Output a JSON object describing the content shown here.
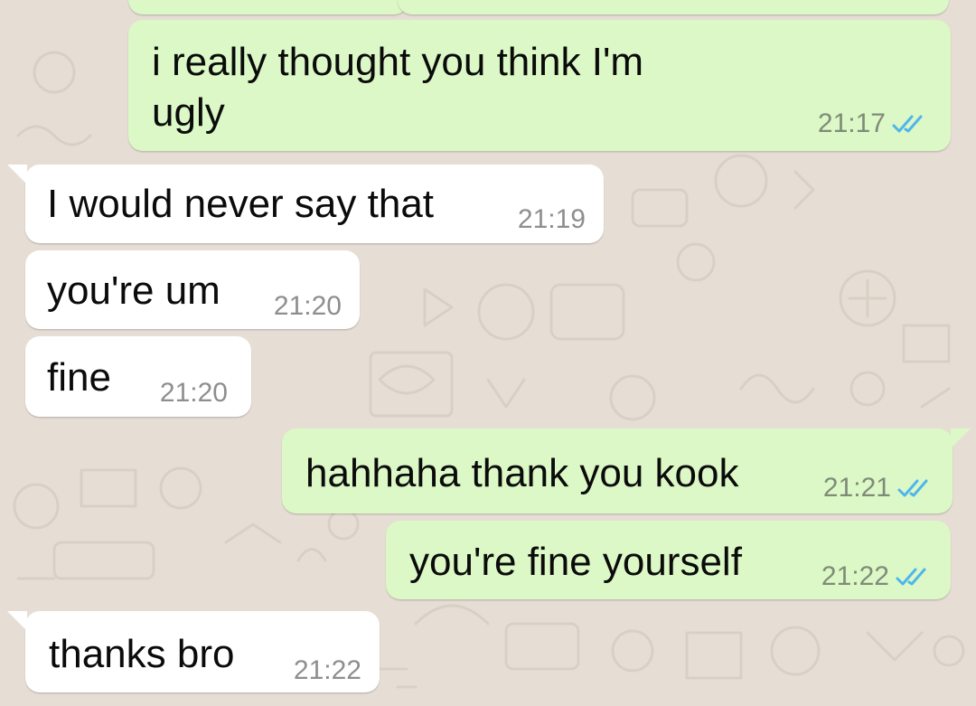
{
  "colors": {
    "wallpaper": "#e6ded5",
    "outgoing_bubble": "#dcf8c6",
    "incoming_bubble": "#ffffff",
    "read_ticks": "#4fb6ec"
  },
  "messages": [
    {
      "direction": "out",
      "lines": [
        "i really thought you think I'm",
        "ugly"
      ],
      "time": "21:17",
      "status": "read",
      "status_icon": "double-check-icon"
    },
    {
      "direction": "in",
      "text": "I would never say that",
      "time": "21:19"
    },
    {
      "direction": "in",
      "text": "you're um",
      "time": "21:20"
    },
    {
      "direction": "in",
      "text": "fine",
      "time": "21:20"
    },
    {
      "direction": "out",
      "text": "hahhaha thank you kook",
      "time": "21:21",
      "status": "read",
      "status_icon": "double-check-icon"
    },
    {
      "direction": "out",
      "text": "you're fine yourself",
      "time": "21:22",
      "status": "read",
      "status_icon": "double-check-icon"
    },
    {
      "direction": "in",
      "text": "thanks bro",
      "time": "21:22"
    }
  ]
}
